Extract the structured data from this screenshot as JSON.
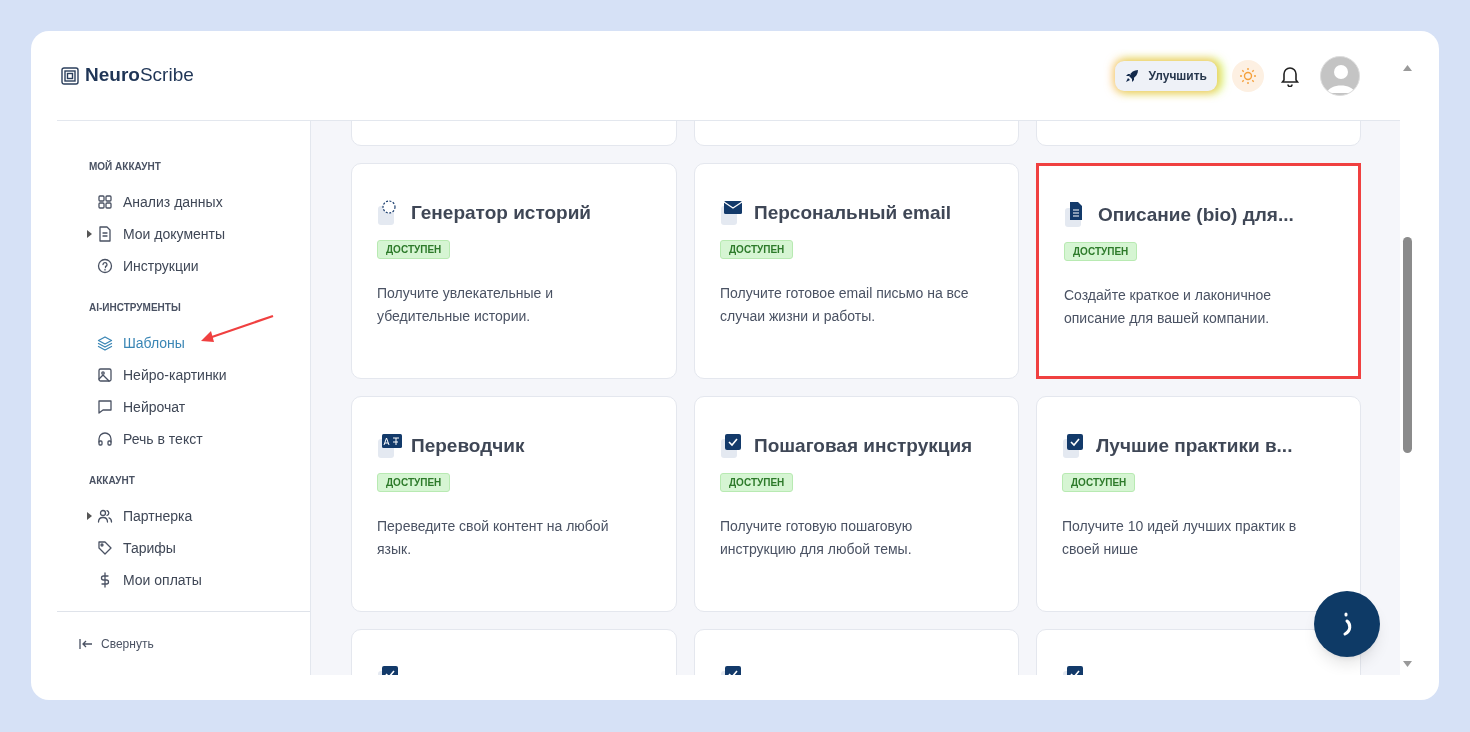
{
  "brand": {
    "bold": "Neuro",
    "light": "Scribe"
  },
  "header": {
    "upgrade_label": "Улучшить"
  },
  "sidebar": {
    "sections": [
      {
        "title": "МОЙ АККАУНТ",
        "items": [
          {
            "kind": "grid",
            "label": "Анализ данных",
            "expandable": false,
            "selected": false
          },
          {
            "kind": "doc",
            "label": "Мои документы",
            "expandable": true,
            "selected": false
          },
          {
            "kind": "help",
            "label": "Инструкции",
            "expandable": false,
            "selected": false
          }
        ]
      },
      {
        "title": "AI-ИНСТРУМЕНТЫ",
        "items": [
          {
            "kind": "layers",
            "label": "Шаблоны",
            "expandable": false,
            "selected": true
          },
          {
            "kind": "image",
            "label": "Нейро-картинки",
            "expandable": false,
            "selected": false
          },
          {
            "kind": "chat",
            "label": "Нейрочат",
            "expandable": false,
            "selected": false
          },
          {
            "kind": "headphones",
            "label": "Речь в текст",
            "expandable": false,
            "selected": false
          }
        ]
      },
      {
        "title": "АККАУНТ",
        "items": [
          {
            "kind": "users",
            "label": "Партнерка",
            "expandable": true,
            "selected": false
          },
          {
            "kind": "tag",
            "label": "Тарифы",
            "expandable": false,
            "selected": false
          },
          {
            "kind": "dollar",
            "label": "Мои оплаты",
            "expandable": false,
            "selected": false
          }
        ]
      }
    ],
    "collapse_label": "Свернуть"
  },
  "cards": [
    {
      "kind": "blank",
      "highlighted": false
    },
    {
      "kind": "blank",
      "highlighted": false
    },
    {
      "kind": "blank",
      "highlighted": false
    },
    {
      "kind": "story",
      "title": "Генератор историй",
      "badge": "ДОСТУПЕН",
      "description": "Получите увлекательные и убедительные истории.",
      "highlighted": false
    },
    {
      "kind": "email",
      "title": "Персональный email",
      "badge": "ДОСТУПЕН",
      "description": "Получите готовое email письмо на все случаи жизни и работы.",
      "highlighted": false
    },
    {
      "kind": "document",
      "title": "Описание (bio) для...",
      "badge": "ДОСТУПЕН",
      "description": "Создайте краткое и лаконичное описание для вашей компании.",
      "highlighted": true
    },
    {
      "kind": "translate",
      "title": "Переводчик",
      "badge": "ДОСТУПЕН",
      "description": "Переведите свой контент на любой язык.",
      "highlighted": false
    },
    {
      "kind": "check",
      "title": "Пошаговая инструкция",
      "badge": "ДОСТУПЕН",
      "description": "Получите готовую пошаговую инструкцию для любой темы.",
      "highlighted": false
    },
    {
      "kind": "check",
      "title": "Лучшие практики в...",
      "badge": "ДОСТУПЕН",
      "description": "Получите 10 идей лучших практик в своей нише",
      "highlighted": false
    },
    {
      "kind": "check",
      "highlighted": false
    },
    {
      "kind": "check",
      "highlighted": false
    },
    {
      "kind": "check",
      "highlighted": false
    }
  ]
}
